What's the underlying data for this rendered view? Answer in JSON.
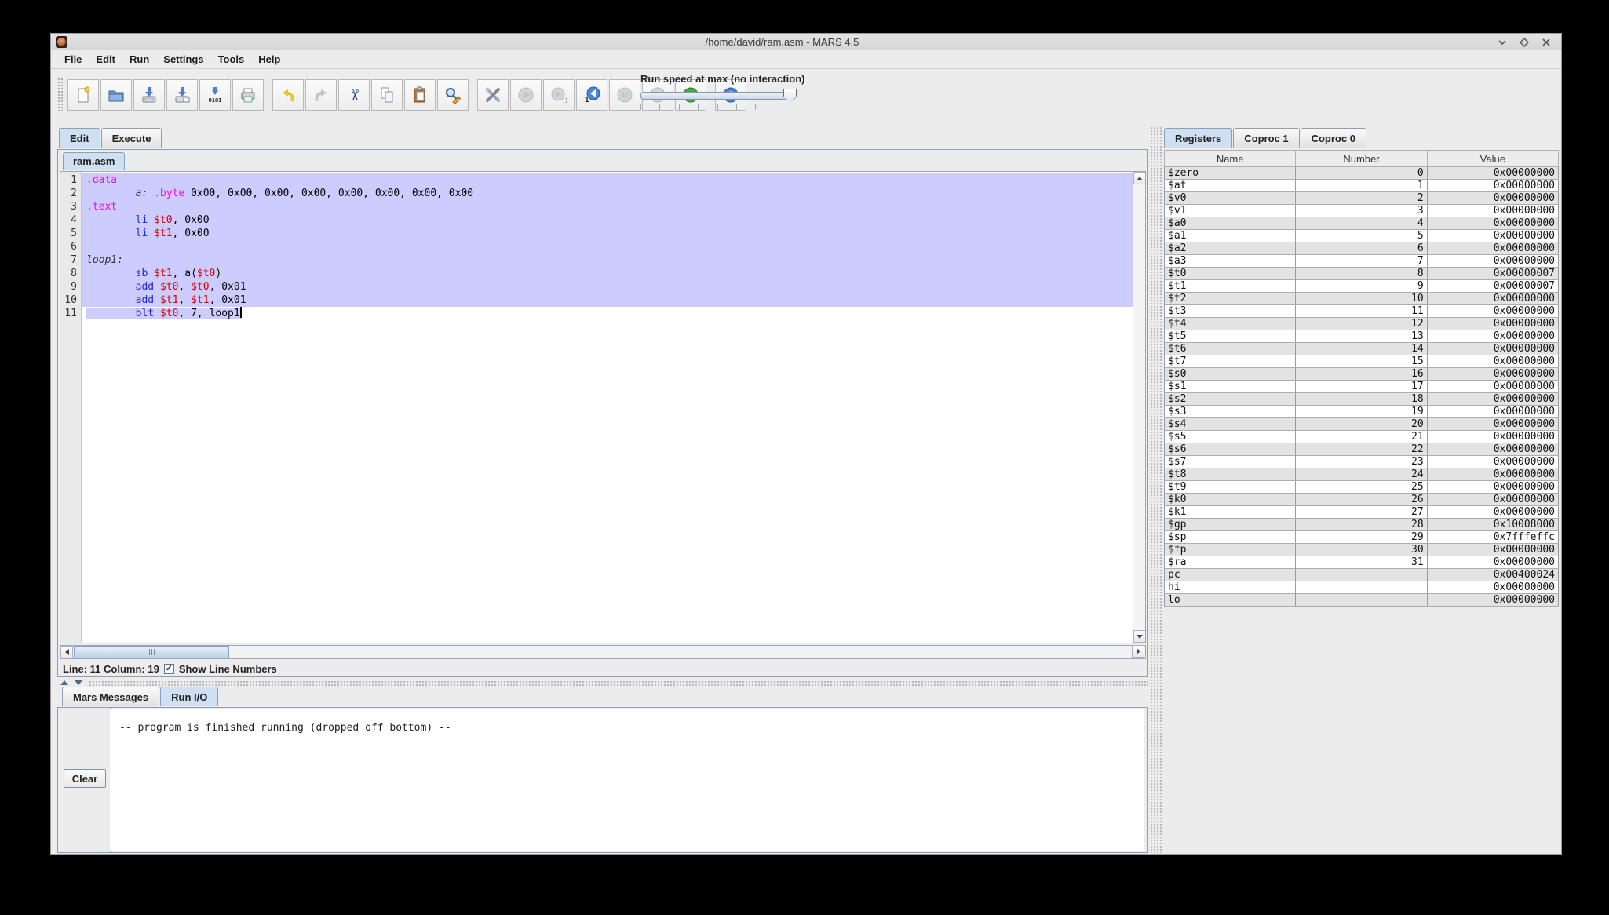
{
  "window": {
    "title": "/home/david/ram.asm - MARS 4.5"
  },
  "menu": {
    "items": [
      "File",
      "Edit",
      "Run",
      "Settings",
      "Tools",
      "Help"
    ]
  },
  "toolbar": {
    "buttons": [
      "new-file",
      "open-file",
      "save",
      "save-as",
      "dump-memory",
      "print",
      "undo",
      "redo",
      "cut",
      "copy",
      "paste",
      "find-replace",
      "assemble",
      "run",
      "step",
      "backstep",
      "pause",
      "stop",
      "reset",
      "help"
    ],
    "dump_icon_text": "0101",
    "cut_icon_glyph": "✂",
    "run_speed_label": "Run speed at max (no interaction)"
  },
  "main_tabs": {
    "edit": "Edit",
    "execute": "Execute"
  },
  "editor": {
    "file_tab": "ram.asm",
    "status": {
      "line_col": "Line: 11 Column: 19",
      "show_line_numbers": "Show Line Numbers",
      "checked": true,
      "check_glyph": "✓"
    },
    "lines": [
      {
        "num": 1,
        "sel": true,
        "tokens": [
          {
            "t": ".data",
            "c": "d"
          }
        ]
      },
      {
        "num": 2,
        "sel": true,
        "tokens": [
          {
            "t": "        ",
            "c": "p"
          },
          {
            "t": "a:",
            "c": "l"
          },
          {
            "t": " ",
            "c": "p"
          },
          {
            "t": ".byte",
            "c": "d"
          },
          {
            "t": " 0x00, 0x00, 0x00, 0x00, 0x00, 0x00, 0x00, 0x00",
            "c": "p"
          }
        ]
      },
      {
        "num": 3,
        "sel": true,
        "tokens": [
          {
            "t": ".text",
            "c": "d"
          }
        ]
      },
      {
        "num": 4,
        "sel": true,
        "tokens": [
          {
            "t": "        ",
            "c": "p"
          },
          {
            "t": "li",
            "c": "i"
          },
          {
            "t": " ",
            "c": "p"
          },
          {
            "t": "$t0",
            "c": "r"
          },
          {
            "t": ", 0x00",
            "c": "p"
          }
        ]
      },
      {
        "num": 5,
        "sel": true,
        "tokens": [
          {
            "t": "        ",
            "c": "p"
          },
          {
            "t": "li",
            "c": "i"
          },
          {
            "t": " ",
            "c": "p"
          },
          {
            "t": "$t1",
            "c": "r"
          },
          {
            "t": ", 0x00",
            "c": "p"
          }
        ]
      },
      {
        "num": 6,
        "sel": true,
        "tokens": []
      },
      {
        "num": 7,
        "sel": true,
        "tokens": [
          {
            "t": "loop1:",
            "c": "l"
          }
        ]
      },
      {
        "num": 8,
        "sel": true,
        "tokens": [
          {
            "t": "        ",
            "c": "p"
          },
          {
            "t": "sb",
            "c": "i"
          },
          {
            "t": " ",
            "c": "p"
          },
          {
            "t": "$t1",
            "c": "r"
          },
          {
            "t": ", a(",
            "c": "p"
          },
          {
            "t": "$t0",
            "c": "r"
          },
          {
            "t": ")",
            "c": "p"
          }
        ]
      },
      {
        "num": 9,
        "sel": true,
        "tokens": [
          {
            "t": "        ",
            "c": "p"
          },
          {
            "t": "add",
            "c": "i"
          },
          {
            "t": " ",
            "c": "p"
          },
          {
            "t": "$t0",
            "c": "r"
          },
          {
            "t": ", ",
            "c": "p"
          },
          {
            "t": "$t0",
            "c": "r"
          },
          {
            "t": ", 0x01",
            "c": "p"
          }
        ]
      },
      {
        "num": 10,
        "sel": true,
        "tokens": [
          {
            "t": "        ",
            "c": "p"
          },
          {
            "t": "add",
            "c": "i"
          },
          {
            "t": " ",
            "c": "p"
          },
          {
            "t": "$t1",
            "c": "r"
          },
          {
            "t": ", ",
            "c": "p"
          },
          {
            "t": "$t1",
            "c": "r"
          },
          {
            "t": ", 0x01",
            "c": "p"
          }
        ]
      },
      {
        "num": 11,
        "sel": false,
        "partial": true,
        "cursor": true,
        "tokens": [
          {
            "t": "        ",
            "c": "p"
          },
          {
            "t": "blt",
            "c": "i"
          },
          {
            "t": " ",
            "c": "p"
          },
          {
            "t": "$t0",
            "c": "r"
          },
          {
            "t": ", 7, ",
            "c": "p"
          },
          {
            "t": "loop1",
            "c": "p"
          }
        ]
      }
    ]
  },
  "console": {
    "tabs": {
      "mars_messages": "Mars Messages",
      "run_io": "Run I/O"
    },
    "clear_label": "Clear",
    "message": "-- program is finished running (dropped off bottom) --"
  },
  "registers_panel": {
    "tabs": [
      "Registers",
      "Coproc 1",
      "Coproc 0"
    ],
    "columns": [
      "Name",
      "Number",
      "Value"
    ],
    "rows": [
      [
        "$zero",
        "0",
        "0x00000000"
      ],
      [
        "$at",
        "1",
        "0x00000000"
      ],
      [
        "$v0",
        "2",
        "0x00000000"
      ],
      [
        "$v1",
        "3",
        "0x00000000"
      ],
      [
        "$a0",
        "4",
        "0x00000000"
      ],
      [
        "$a1",
        "5",
        "0x00000000"
      ],
      [
        "$a2",
        "6",
        "0x00000000"
      ],
      [
        "$a3",
        "7",
        "0x00000000"
      ],
      [
        "$t0",
        "8",
        "0x00000007"
      ],
      [
        "$t1",
        "9",
        "0x00000007"
      ],
      [
        "$t2",
        "10",
        "0x00000000"
      ],
      [
        "$t3",
        "11",
        "0x00000000"
      ],
      [
        "$t4",
        "12",
        "0x00000000"
      ],
      [
        "$t5",
        "13",
        "0x00000000"
      ],
      [
        "$t6",
        "14",
        "0x00000000"
      ],
      [
        "$t7",
        "15",
        "0x00000000"
      ],
      [
        "$s0",
        "16",
        "0x00000000"
      ],
      [
        "$s1",
        "17",
        "0x00000000"
      ],
      [
        "$s2",
        "18",
        "0x00000000"
      ],
      [
        "$s3",
        "19",
        "0x00000000"
      ],
      [
        "$s4",
        "20",
        "0x00000000"
      ],
      [
        "$s5",
        "21",
        "0x00000000"
      ],
      [
        "$s6",
        "22",
        "0x00000000"
      ],
      [
        "$s7",
        "23",
        "0x00000000"
      ],
      [
        "$t8",
        "24",
        "0x00000000"
      ],
      [
        "$t9",
        "25",
        "0x00000000"
      ],
      [
        "$k0",
        "26",
        "0x00000000"
      ],
      [
        "$k1",
        "27",
        "0x00000000"
      ],
      [
        "$gp",
        "28",
        "0x10008000"
      ],
      [
        "$sp",
        "29",
        "0x7fffeffc"
      ],
      [
        "$fp",
        "30",
        "0x00000000"
      ],
      [
        "$ra",
        "31",
        "0x00000000"
      ],
      [
        "pc",
        "",
        "0x00400024"
      ],
      [
        "hi",
        "",
        "0x00000000"
      ],
      [
        "lo",
        "",
        "0x00000000"
      ]
    ]
  },
  "colors": {
    "selection": "#ccccff",
    "directive": "#ff00ff",
    "instruction": "#2222ee",
    "register": "#e00000",
    "label": "#333333",
    "selected_tab": "#cfe0f2"
  }
}
